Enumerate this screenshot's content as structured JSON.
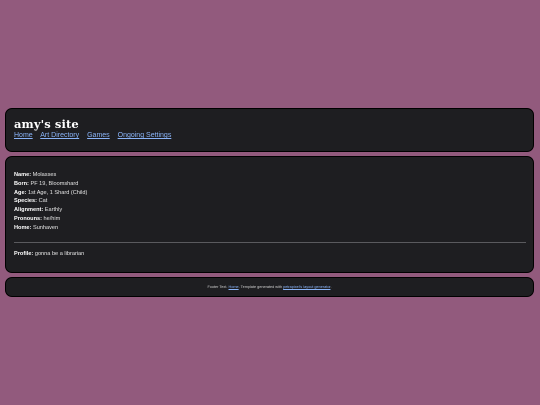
{
  "site": {
    "title": "amy's site"
  },
  "nav": {
    "items": [
      {
        "label": "Home"
      },
      {
        "label": "Art Directory"
      },
      {
        "label": "Games"
      },
      {
        "label": "Ongoing Settings"
      }
    ]
  },
  "character": {
    "fields": [
      {
        "label": "Name:",
        "value": " Molasses"
      },
      {
        "label": "Born:",
        "value": " PF 19, Bloomshard"
      },
      {
        "label": "Age:",
        "value": " 1st Age, 1 Shard (Child)"
      },
      {
        "label": "Species:",
        "value": " Cat"
      },
      {
        "label": "Alignment:",
        "value": " Earthly"
      },
      {
        "label": "Pronouns:",
        "value": " he/him"
      },
      {
        "label": "Home:",
        "value": " Sunhaven"
      }
    ],
    "profile": {
      "label": "Profile:",
      "value": " gonna be a librarian"
    }
  },
  "footer": {
    "prefix": "Footer Text. ",
    "home_link": "Home",
    "middle": ". Template generated with ",
    "generator_link": "petrapixel's layout generator",
    "suffix": "."
  },
  "colors": {
    "background": "#925a7d",
    "panel": "#1e1e21",
    "link": "#8ab4f8"
  }
}
